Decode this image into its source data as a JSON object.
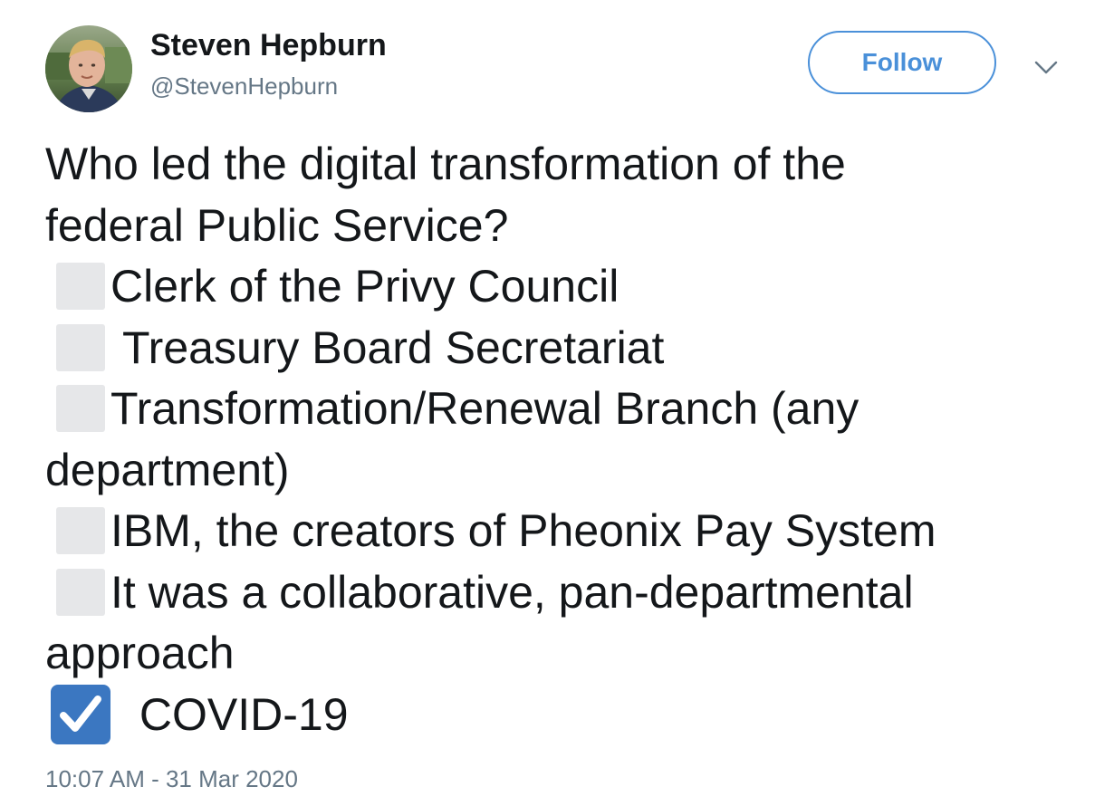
{
  "tweet": {
    "author": {
      "display_name": "Steven Hepburn",
      "handle": "@StevenHepburn"
    },
    "follow_label": "Follow",
    "question_line1": "Who led the digital transformation of the",
    "question_line2": "federal Public Service?",
    "options": {
      "o1": "Clerk of the Privy Council",
      "o2": " Treasury Board Secretariat",
      "o3_line1": "Transformation/Renewal Branch (any",
      "o3_line2": "department)",
      "o4": "IBM, the creators of Pheonix Pay System",
      "o5_line1": "It was a collaborative, pan-departmental",
      "o5_line2": "approach",
      "o6": " COVID-19"
    },
    "timestamp": "10:07 AM - 31 Mar 2020"
  },
  "colors": {
    "accent": "#4a90d9",
    "checkbox_empty": "#e6e7e9",
    "checkbox_checked": "#3b77c1",
    "secondary_text": "#657786"
  },
  "icons": {
    "caret": "chevron-down-icon",
    "checked": "ballot-box-with-check-icon",
    "empty": "white-square-icon"
  }
}
